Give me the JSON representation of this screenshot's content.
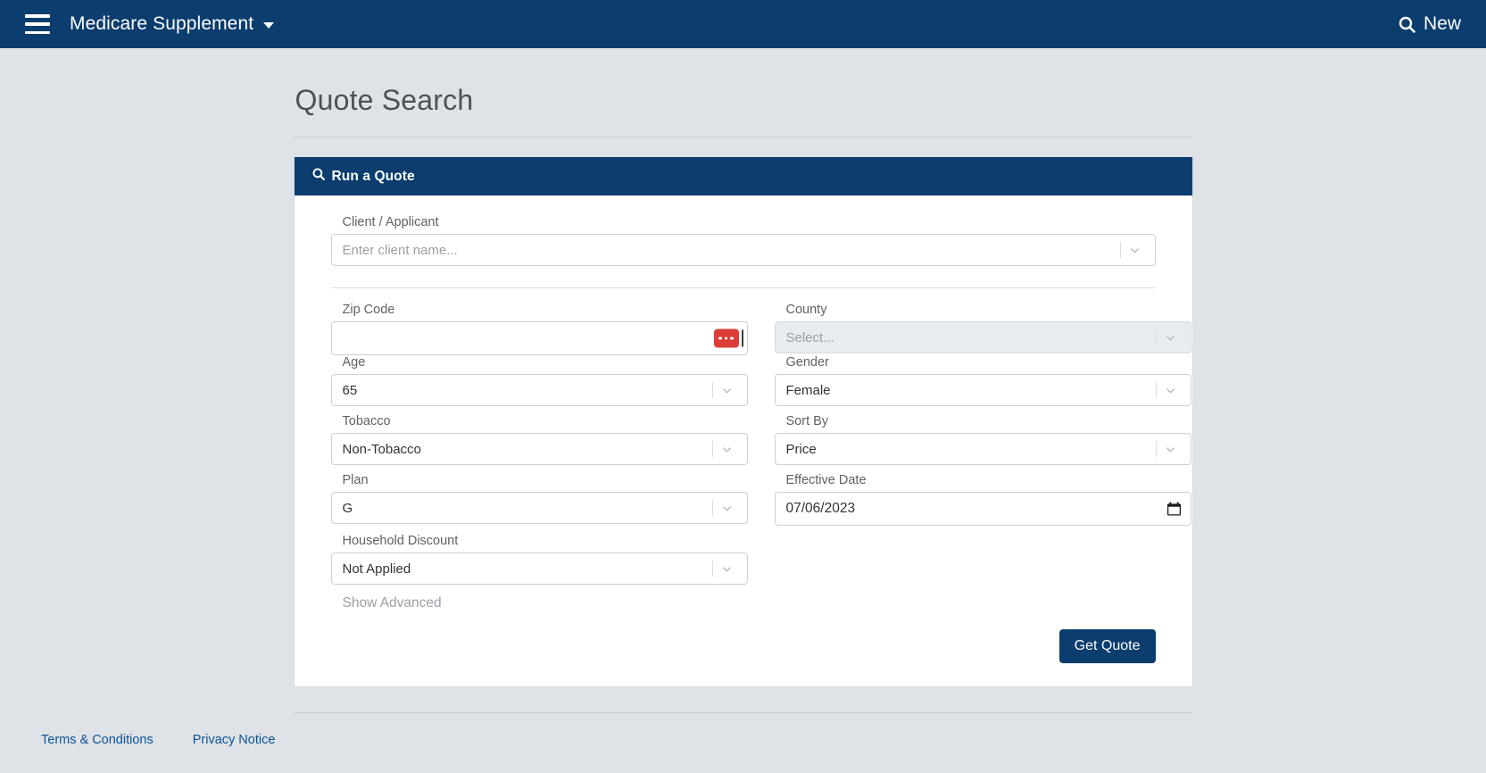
{
  "navbar": {
    "menu_icon": "hamburger-icon",
    "brand": "Medicare Supplement",
    "brand_caret": "caret-down-icon",
    "new_icon": "search-icon",
    "new_label": "New",
    "background": "#0b3d6e"
  },
  "page": {
    "title": "Quote Search"
  },
  "card": {
    "header_icon": "search-icon",
    "header_title": "Run a Quote",
    "header_background": "#0b3d6e"
  },
  "form": {
    "client": {
      "label": "Client / Applicant",
      "placeholder": "Enter client name...",
      "value": "",
      "dropdown_icon": "chevron-down-icon"
    },
    "zip": {
      "label": "Zip Code",
      "value": "",
      "badge": "ellipsis-icon",
      "badge_color": "#dc3d36"
    },
    "county": {
      "label": "County",
      "placeholder": "Select...",
      "value": "",
      "disabled": true,
      "dropdown_icon": "chevron-down-icon"
    },
    "age": {
      "label": "Age",
      "value": "65",
      "dropdown_icon": "chevron-down-icon"
    },
    "gender": {
      "label": "Gender",
      "value": "Female",
      "dropdown_icon": "chevron-down-icon"
    },
    "tobacco": {
      "label": "Tobacco",
      "value": "Non-Tobacco",
      "dropdown_icon": "chevron-down-icon"
    },
    "sort_by": {
      "label": "Sort By",
      "value": "Price",
      "dropdown_icon": "chevron-down-icon"
    },
    "plan": {
      "label": "Plan",
      "value": "G",
      "dropdown_icon": "chevron-down-icon"
    },
    "effective_date": {
      "label": "Effective Date",
      "value": "07/06/2023",
      "picker_icon": "calendar-icon"
    },
    "household_discount": {
      "label": "Household Discount",
      "value": "Not Applied",
      "dropdown_icon": "chevron-down-icon"
    },
    "show_advanced": "Show Advanced",
    "submit_label": "Get Quote"
  },
  "footer": {
    "links": [
      {
        "label": "Terms & Conditions"
      },
      {
        "label": "Privacy Notice"
      }
    ]
  }
}
